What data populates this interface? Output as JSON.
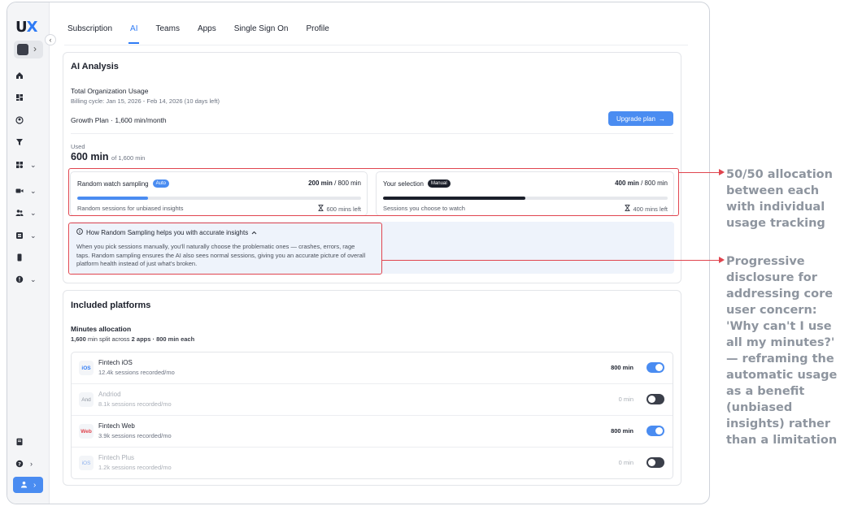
{
  "sidebar": {
    "logo_u": "U",
    "logo_x": "X",
    "collapse": "‹",
    "ws_chev": "›"
  },
  "tabs": [
    {
      "label": "Subscription",
      "active": false
    },
    {
      "label": "AI",
      "active": true
    },
    {
      "label": "Teams",
      "active": false
    },
    {
      "label": "Apps",
      "active": false
    },
    {
      "label": "Single Sign On",
      "active": false
    },
    {
      "label": "Profile",
      "active": false
    }
  ],
  "ai": {
    "title": "AI Analysis",
    "org_usage_title": "Total Organization Usage",
    "billing_cycle": "Billing cycle: Jan 15, 2026 - Feb 14, 2026 (10 days left)",
    "plan": "Growth Plan · 1,600 min/month",
    "upgrade_label": "Upgrade plan",
    "upgrade_arrow": "→",
    "used_label": "Used",
    "used_value": "600 min",
    "used_of": "of 1,600 min",
    "random": {
      "title": "Random watch sampling",
      "badge": "Auto",
      "used": "200 min",
      "total": "/ 800 min",
      "fill": 0.25,
      "desc": "Random sessions for unbiased insights",
      "left": "600 mins left"
    },
    "selection": {
      "title": "Your selection",
      "badge": "Manual",
      "used": "400 min",
      "total": "/ 800 min",
      "fill": 0.5,
      "desc": "Sessions you choose to watch",
      "left": "400 mins left"
    },
    "disclosure": {
      "head": "How Random Sampling helps you with accurate insights",
      "body": "When you pick sessions manually, you'll naturally choose the problematic ones — crashes, errors, rage taps. Random sampling ensures the AI also sees normal sessions, giving you an accurate picture of overall platform health instead of just what's broken."
    }
  },
  "platforms": {
    "title": "Included platforms",
    "alloc_title": "Minutes allocation",
    "alloc_total": "1,600",
    "alloc_rest": " min split across ",
    "alloc_bold": "2 apps · 800 min each",
    "items": [
      {
        "badge": "iOS",
        "name": "Fintech iOS",
        "sub": "12.4k sessions recorded/mo",
        "min": "800 min",
        "on": true
      },
      {
        "badge": "And",
        "name": "Andriod",
        "sub": "8.1k sessions recorded/mo",
        "min": "0 min",
        "on": false
      },
      {
        "badge": "Web",
        "name": "Fintech Web",
        "sub": "3.9k sessions recorded/mo",
        "min": "800 min",
        "on": true
      },
      {
        "badge": "iOS",
        "name": "Fintech Plus",
        "sub": "1.2k sessions recorded/mo",
        "min": "0 min",
        "on": false
      }
    ]
  },
  "annotations": {
    "one": "50/50 allocation between each with individual usage tracking",
    "two": "Progressive disclosure for addressing core user concern: 'Why can't I use all my minutes?' — reframing the automatic usage as a benefit (unbiased insights) rather than a limitation"
  },
  "colors": {
    "accent": "#4a8cf1",
    "dark": "#1b1f2a",
    "annotation_red": "#e0454f"
  }
}
